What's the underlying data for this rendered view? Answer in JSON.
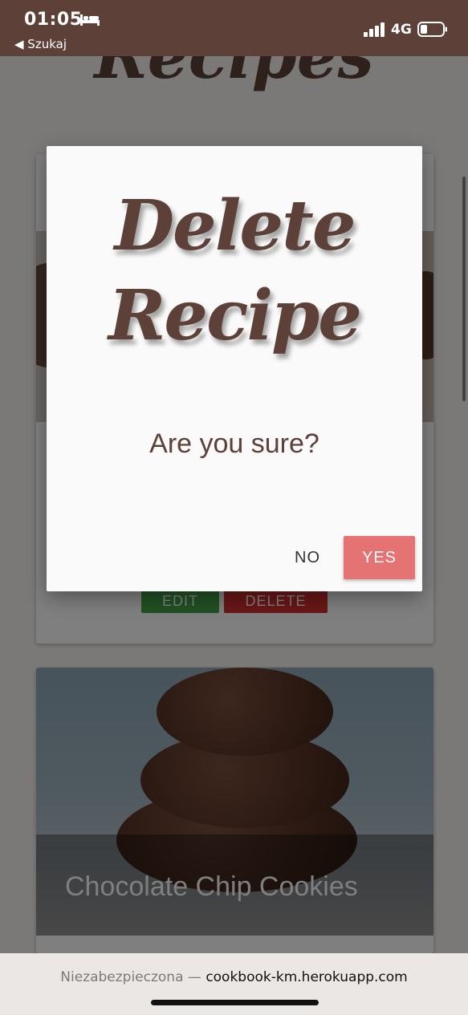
{
  "status_bar": {
    "time": "01:05",
    "back_label": "◀ Szukaj",
    "network": "4G",
    "bed_icon": "bed-icon",
    "signal_icon": "signal-bars-icon",
    "battery_icon": "battery-icon",
    "background_color": "#5d4037"
  },
  "page": {
    "title": "Recipes",
    "card1": {
      "edit_label": "EDIT",
      "delete_label": "DELETE"
    },
    "card2": {
      "title": "Chocolate Chip Cookies"
    }
  },
  "modal": {
    "title_line1": "Delete",
    "title_line2": "Recipe",
    "message": "Are you sure?",
    "no_label": "NO",
    "yes_label": "YES",
    "yes_color": "#e57373",
    "title_color": "#5d4037"
  },
  "browser_bar": {
    "insecure_label": "Niezabezpieczona —",
    "host": "cookbook-km.herokuapp.com"
  }
}
